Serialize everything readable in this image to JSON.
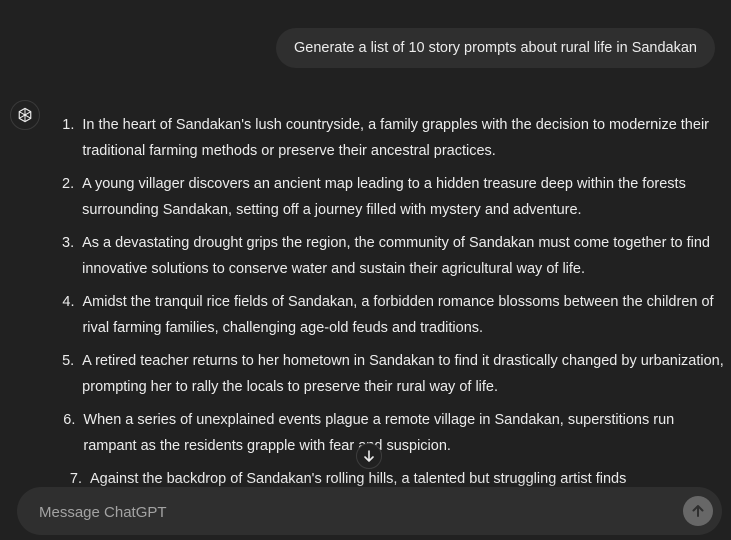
{
  "conversation": {
    "user_message": "Generate a list of 10 story prompts about rural life in Sandakan",
    "assistant_items": [
      {
        "num": "1.",
        "text": "In the heart of Sandakan's lush countryside, a family grapples with the decision to modernize their traditional farming methods or preserve their ancestral practices."
      },
      {
        "num": "2.",
        "text": "A young villager discovers an ancient map leading to a hidden treasure deep within the forests surrounding Sandakan, setting off a journey filled with mystery and adventure."
      },
      {
        "num": "3.",
        "text": "As a devastating drought grips the region, the community of Sandakan must come together to find innovative solutions to conserve water and sustain their agricultural way of life."
      },
      {
        "num": "4.",
        "text": "Amidst the tranquil rice fields of Sandakan, a forbidden romance blossoms between the children of rival farming families, challenging age-old feuds and traditions."
      },
      {
        "num": "5.",
        "text": "A retired teacher returns to her hometown in Sandakan to find it drastically changed by urbanization, prompting her to rally the locals to preserve their rural way of life."
      },
      {
        "num": "6.",
        "text": "When a series of unexplained events plague a remote village in Sandakan, superstitions run rampant as the residents grapple with fear and suspicion."
      },
      {
        "num": "7.",
        "text": "Against the backdrop of Sandakan's rolling hills, a talented but struggling artist finds"
      }
    ]
  },
  "composer": {
    "placeholder": "Message ChatGPT"
  },
  "icons": {
    "assistant_avatar": "openai-logo-icon",
    "scroll_down": "arrow-down-icon",
    "send": "arrow-up-icon"
  }
}
